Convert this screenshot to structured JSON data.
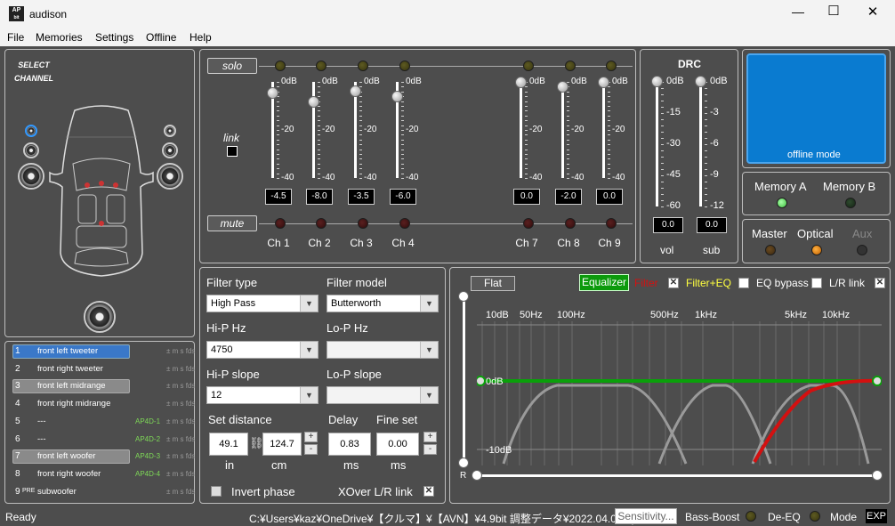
{
  "window": {
    "app_icon": "AP bit",
    "title": "audison"
  },
  "menu": [
    "File",
    "Memories",
    "Settings",
    "Offline",
    "Help"
  ],
  "select_channel": {
    "title_line1": "SELECT",
    "title_line2": "CHANNEL"
  },
  "channels": [
    {
      "num": "1",
      "pre": "",
      "name": "front left tweeter",
      "ap": "",
      "ms": "± m s fds",
      "selected": "blue"
    },
    {
      "num": "2",
      "pre": "",
      "name": "front right tweeter",
      "ap": "",
      "ms": "± m s fds",
      "selected": ""
    },
    {
      "num": "3",
      "pre": "",
      "name": "front left midrange",
      "ap": "",
      "ms": "± m s fds",
      "selected": "gray"
    },
    {
      "num": "4",
      "pre": "",
      "name": "front right midrange",
      "ap": "",
      "ms": "± m s fds",
      "selected": ""
    },
    {
      "num": "5",
      "pre": "",
      "name": "---",
      "ap": "AP4D-1",
      "ms": "± m s fds",
      "selected": ""
    },
    {
      "num": "6",
      "pre": "",
      "name": "---",
      "ap": "AP4D-2",
      "ms": "± m s fds",
      "selected": ""
    },
    {
      "num": "7",
      "pre": "",
      "name": "front left woofer",
      "ap": "AP4D-3",
      "ms": "± m s fds",
      "selected": "gray"
    },
    {
      "num": "8",
      "pre": "",
      "name": "front right woofer",
      "ap": "AP4D-4",
      "ms": "± m s fds",
      "selected": ""
    },
    {
      "num": "9",
      "pre": "PRE",
      "name": "subwoofer",
      "ap": "",
      "ms": "± m s fds",
      "selected": ""
    }
  ],
  "mixer": {
    "solo_label": "solo",
    "mute_label": "mute",
    "link_label": "link",
    "scale": [
      "0dB",
      "-20",
      "-40"
    ],
    "faders": [
      {
        "name": "Ch 1",
        "value": "-4.5",
        "level": 0.11
      },
      {
        "name": "Ch 2",
        "value": "-8.0",
        "level": 0.2
      },
      {
        "name": "Ch 3",
        "value": "-3.5",
        "level": 0.09
      },
      {
        "name": "Ch 4",
        "value": "-6.0",
        "level": 0.15
      },
      {
        "name": "Ch 7",
        "value": "0.0",
        "level": 0.0
      },
      {
        "name": "Ch 8",
        "value": "-2.0",
        "level": 0.05
      },
      {
        "name": "Ch 9",
        "value": "0.0",
        "level": 0.0
      }
    ]
  },
  "drc": {
    "title": "DRC",
    "vol_scale": [
      "0dB",
      "-15",
      "-30",
      "-45",
      "-60"
    ],
    "sub_scale": [
      "0dB",
      "-3",
      "-6",
      "-9",
      "-12"
    ],
    "vol_value": "0.0",
    "sub_value": "0.0",
    "vol_label": "vol",
    "sub_label": "sub"
  },
  "offline_box": {
    "text": "offline mode"
  },
  "memory": {
    "a": "Memory A",
    "b": "Memory B"
  },
  "source": {
    "master": "Master",
    "optical": "Optical",
    "aux": "Aux"
  },
  "filter": {
    "filter_type_label": "Filter type",
    "filter_type": "High Pass",
    "filter_model_label": "Filter model",
    "filter_model": "Butterworth",
    "hip_hz_label": "Hi-P Hz",
    "hip_hz": "4750",
    "lop_hz_label": "Lo-P Hz",
    "lop_hz": "",
    "hip_slope_label": "Hi-P slope",
    "hip_slope": "12",
    "lop_slope_label": "Lo-P slope",
    "lop_slope": "",
    "set_distance_label": "Set distance",
    "dist_in": "49.1",
    "dist_cm": "124.7",
    "unit_in": "in",
    "unit_cm": "cm",
    "delay_label": "Delay",
    "delay": "0.83",
    "fine_label": "Fine set",
    "fine": "0.00",
    "unit_ms": "ms",
    "invert_label": "Invert phase",
    "xover_label": "XOver L/R link"
  },
  "eq": {
    "flat": "Flat",
    "equalizer": "Equalizer",
    "filter": "Filter",
    "filter_eq": "Filter+EQ",
    "eq_bypass": "EQ bypass",
    "lr_link": "L/R link",
    "freq_labels": [
      "10dB",
      "50Hz",
      "100Hz",
      "500Hz",
      "1kHz",
      "5kHz",
      "10kHz"
    ],
    "db_top": "10dB",
    "db_mid": "0dB",
    "db_bottom": "-10dB",
    "r_label": "R",
    "colors": {
      "eq_line": "#0aa00a",
      "filter_line": "#d41010",
      "other_curves": "#9a9a9a"
    }
  },
  "status": {
    "ready": "Ready",
    "path": "C:¥Users¥kaz¥OneDrive¥【クルマ】¥【AVN】¥4.9bit 調整データ¥2022.04.03.aps",
    "sensitivity": "Sensitivity...",
    "bass_boost": "Bass-Boost",
    "de_eq": "De-EQ",
    "mode": "Mode",
    "exp": "EXP"
  }
}
